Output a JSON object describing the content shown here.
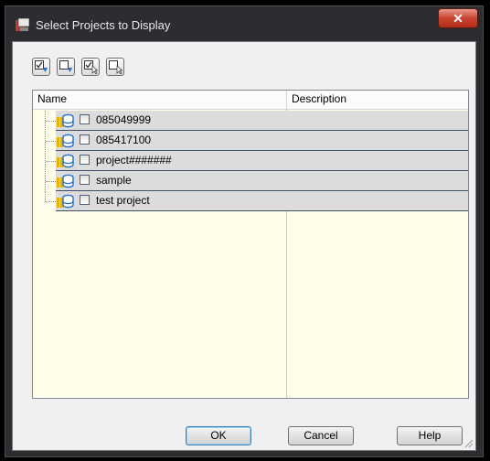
{
  "window": {
    "title": "Select Projects to Display",
    "close_symbol": "✕"
  },
  "toolbar": {
    "buttons": [
      {
        "name": "select-all-recursive-button",
        "icon": "check-arrow-down-icon"
      },
      {
        "name": "clear-all-recursive-button",
        "icon": "box-arrow-down-icon"
      },
      {
        "name": "select-all-button",
        "icon": "check-cursor-icon"
      },
      {
        "name": "clear-all-button",
        "icon": "box-cursor-icon"
      }
    ]
  },
  "table": {
    "columns": [
      "Name",
      "Description"
    ],
    "rows": [
      {
        "name": "085049999",
        "description": "",
        "checked": false
      },
      {
        "name": "085417100",
        "description": "",
        "checked": false
      },
      {
        "name": "project#######",
        "description": "",
        "checked": false
      },
      {
        "name": "sample",
        "description": "",
        "checked": false
      },
      {
        "name": "test project",
        "description": "",
        "checked": false
      }
    ]
  },
  "buttons": {
    "ok": "OK",
    "cancel": "Cancel",
    "help": "Help"
  },
  "colors": {
    "panel_bg": "#fffeeb",
    "row_bg": "#dcdcdc",
    "row_border": "#41506a",
    "chrome": "#2b2d30"
  }
}
